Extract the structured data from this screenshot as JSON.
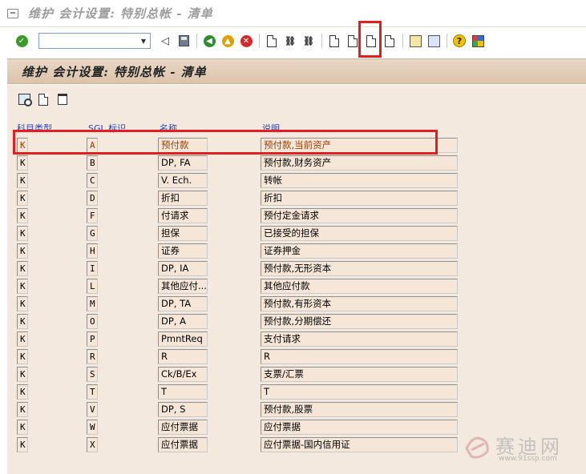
{
  "window": {
    "title": "维护 会计设置: 特别总帐 - 清单"
  },
  "toolbar": {
    "command_value": "",
    "icons": [
      "enter-check-icon",
      "save-icon",
      "back-icon",
      "exit-icon",
      "cancel-icon",
      "print-icon",
      "find-icon",
      "find-next-icon",
      "first-page-icon",
      "previous-page-icon",
      "next-page-icon",
      "last-page-icon",
      "new-session-icon",
      "shortcut-icon",
      "help-icon",
      "layout-icon"
    ]
  },
  "screen": {
    "title": "维护 会计设置: 特别总帐 - 清单",
    "icons": [
      "details-icon",
      "create-icon",
      "delete-icon"
    ]
  },
  "table": {
    "headers": {
      "account_type": "科目类型",
      "sgl_indicator": "SGL 标识",
      "name": "名称",
      "description": "说明"
    },
    "rows": [
      {
        "type": "K",
        "sgl": "A",
        "name": "预付款",
        "desc": "预付款,当前资产"
      },
      {
        "type": "K",
        "sgl": "B",
        "name": "DP, FA",
        "desc": "预付款,财务资产"
      },
      {
        "type": "K",
        "sgl": "C",
        "name": "V. Ech.",
        "desc": "转帐"
      },
      {
        "type": "K",
        "sgl": "D",
        "name": "折扣",
        "desc": "折扣"
      },
      {
        "type": "K",
        "sgl": "F",
        "name": "付请求",
        "desc": "预付定金请求"
      },
      {
        "type": "K",
        "sgl": "G",
        "name": "担保",
        "desc": "已接受的担保"
      },
      {
        "type": "K",
        "sgl": "H",
        "name": "证券",
        "desc": "证券押金"
      },
      {
        "type": "K",
        "sgl": "I",
        "name": "DP, IA",
        "desc": "预付款,无形资本"
      },
      {
        "type": "K",
        "sgl": "L",
        "name": "其他应付...",
        "desc": "其他应付款"
      },
      {
        "type": "K",
        "sgl": "M",
        "name": "DP, TA",
        "desc": "预付款,有形资本"
      },
      {
        "type": "K",
        "sgl": "O",
        "name": "DP, A",
        "desc": "预付款,分期偿还"
      },
      {
        "type": "K",
        "sgl": "P",
        "name": "PmntReq",
        "desc": "支付请求"
      },
      {
        "type": "K",
        "sgl": "R",
        "name": "R",
        "desc": "R"
      },
      {
        "type": "K",
        "sgl": "S",
        "name": "Ck/B/Ex",
        "desc": "支票/汇票"
      },
      {
        "type": "K",
        "sgl": "T",
        "name": "T",
        "desc": "T"
      },
      {
        "type": "K",
        "sgl": "V",
        "name": "DP, S",
        "desc": "预付款,股票"
      },
      {
        "type": "K",
        "sgl": "W",
        "name": "应付票据",
        "desc": "应付票据"
      },
      {
        "type": "K",
        "sgl": "X",
        "name": "应付票据",
        "desc": "应付票据-国内信用证"
      }
    ]
  },
  "watermark": {
    "name": "赛迪网",
    "url": "www.91ssp.com"
  },
  "colors": {
    "highlight": "#e02020",
    "header_text": "#2a3fc4",
    "content_bg": "#f3e9df",
    "banner_bg": "#e2ccb5"
  }
}
